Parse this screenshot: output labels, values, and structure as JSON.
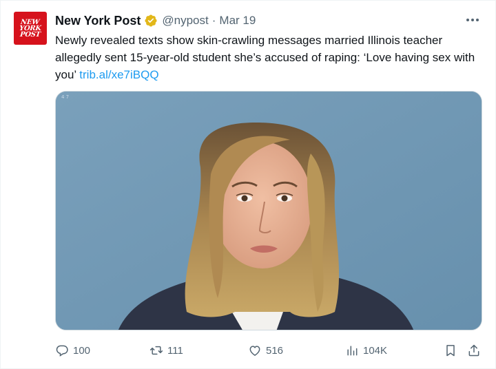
{
  "tweet": {
    "author_name": "New York Post",
    "handle": "@nypost",
    "separator": "·",
    "date": "Mar 19",
    "text": "Newly revealed texts show skin-crawling messages married Illinois teacher allegedly sent 15-year-old student she’s accused of raping: ‘Love having sex with you’",
    "link": "trib.al/xe7iBQQ",
    "avatar_logo": [
      "NEW",
      "YORK",
      "POST"
    ],
    "media_icon": "mugshot-photo"
  },
  "actions": {
    "replies": "100",
    "retweets": "111",
    "likes": "516",
    "views": "104K"
  },
  "colors": {
    "link": "#1d9bf0",
    "secondary_text": "#536471",
    "brand_red": "#d6121c",
    "verified_gold": "#e2b719"
  }
}
